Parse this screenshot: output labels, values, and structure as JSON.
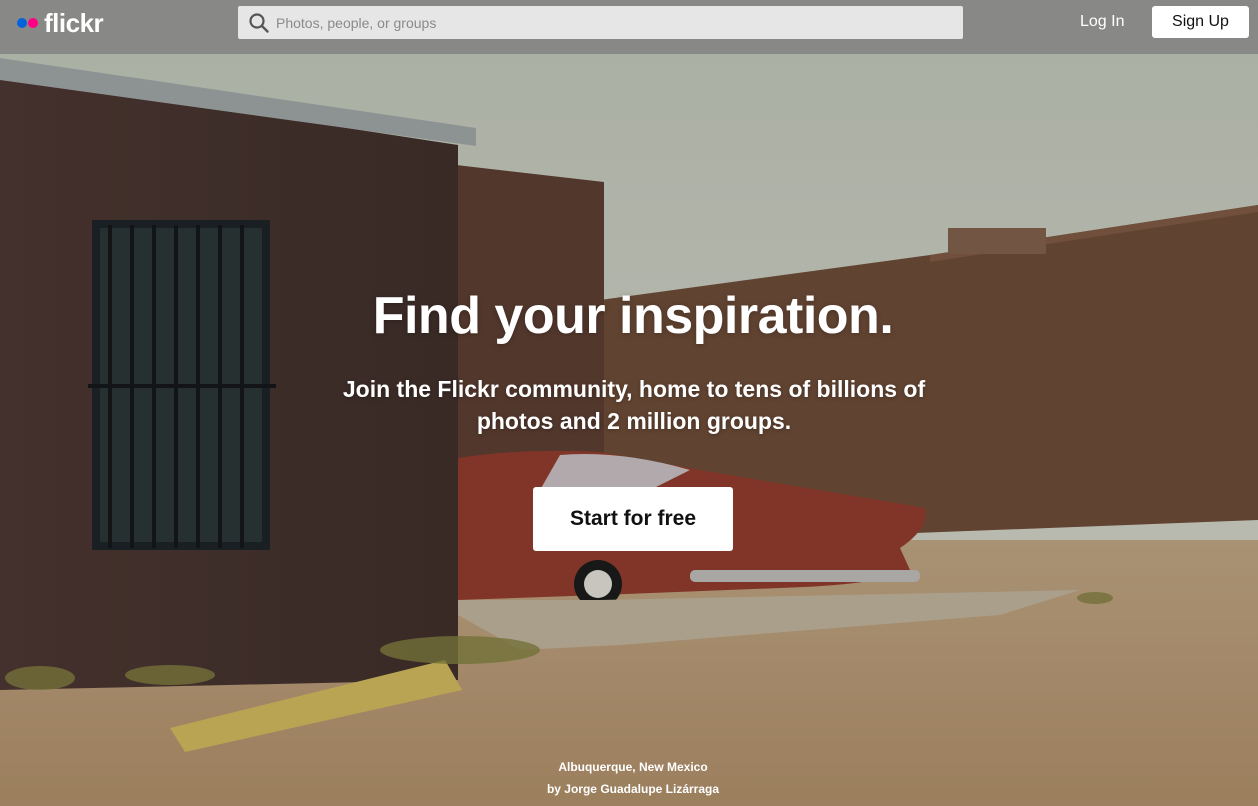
{
  "header": {
    "logo_text": "flickr",
    "search_placeholder": "Photos, people, or groups",
    "login_label": "Log In",
    "signup_label": "Sign Up"
  },
  "hero": {
    "headline": "Find your inspiration.",
    "subline": "Join the Flickr community, home to tens of billions of photos and 2 million groups.",
    "cta_label": "Start for free"
  },
  "photo_credit": {
    "location": "Albuquerque, New Mexico",
    "author": "by Jorge Guadalupe Lizárraga"
  },
  "colors": {
    "logo_blue": "#0063dc",
    "logo_pink": "#ff0084"
  }
}
